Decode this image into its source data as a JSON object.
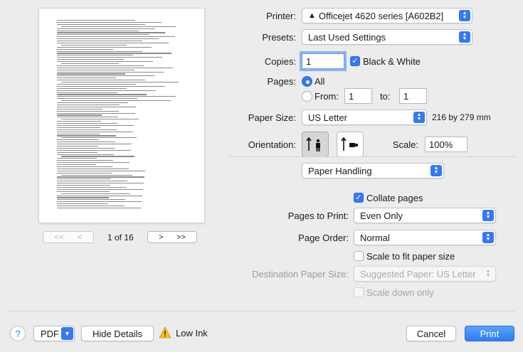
{
  "preview": {
    "page_index": "1 of 16",
    "nav": {
      "first": "<<",
      "prev": "<",
      "next": ">",
      "last": ">>"
    }
  },
  "printer": {
    "label": "Printer:",
    "value": "Officejet 4620 series [A602B2]"
  },
  "presets": {
    "label": "Presets:",
    "value": "Last Used Settings"
  },
  "copies": {
    "label": "Copies:",
    "value": "1",
    "bw_label": "Black & White",
    "bw_checked": true
  },
  "pages": {
    "label": "Pages:",
    "all_label": "All",
    "from_label": "From:",
    "to_label": "to:",
    "from_value": "1",
    "to_value": "1"
  },
  "paper_size": {
    "label": "Paper Size:",
    "value": "US Letter",
    "dims": "216 by 279 mm"
  },
  "orientation": {
    "label": "Orientation:"
  },
  "scale": {
    "label": "Scale:",
    "value": "100%"
  },
  "section": {
    "value": "Paper Handling"
  },
  "collate": {
    "label": "Collate pages",
    "checked": true
  },
  "pages_to_print": {
    "label": "Pages to Print:",
    "value": "Even Only"
  },
  "page_order": {
    "label": "Page Order:",
    "value": "Normal"
  },
  "scale_fit": {
    "label": "Scale to fit paper size",
    "checked": false
  },
  "dest_paper": {
    "label": "Destination Paper Size:",
    "value": "Suggested Paper: US Letter"
  },
  "scale_down": {
    "label": "Scale down only",
    "checked": false
  },
  "footer": {
    "help": "?",
    "pdf": "PDF",
    "hide_details": "Hide Details",
    "low_ink": "Low Ink",
    "cancel": "Cancel",
    "print": "Print"
  },
  "colors": {
    "accent": "#3478f6",
    "warning": "#f5c518"
  }
}
